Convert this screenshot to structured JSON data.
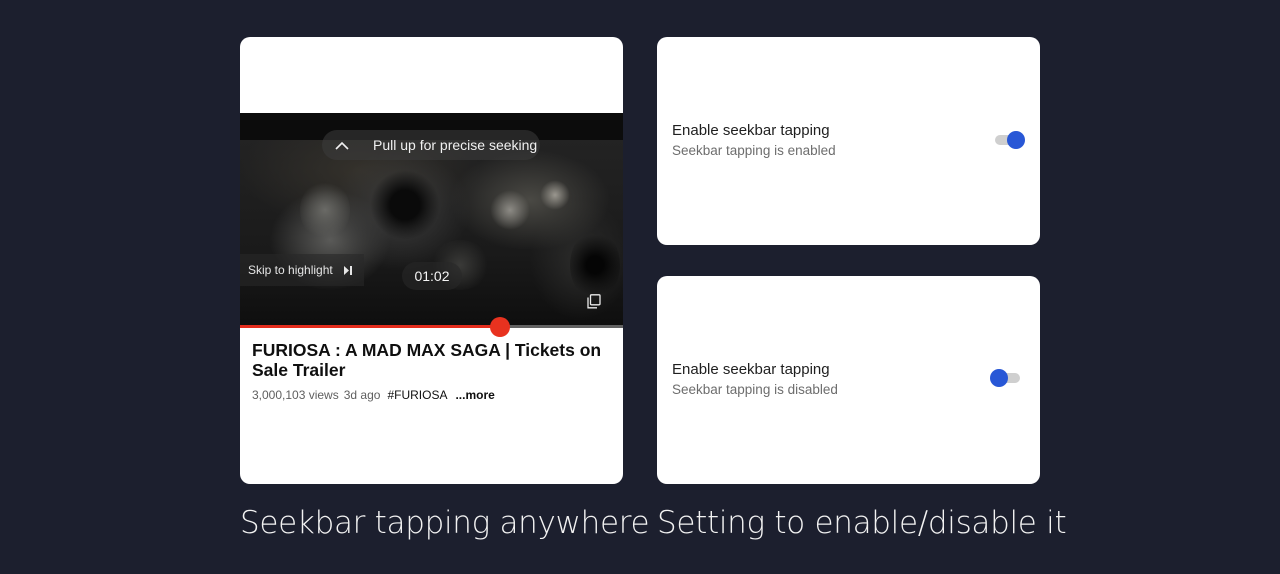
{
  "video": {
    "pull_hint": "Pull up for precise seeking",
    "skip_label": "Skip to highlight",
    "time": "01:02",
    "progress": 0.68,
    "title": "FURIOSA : A MAD MAX SAGA | Tickets on Sale Trailer",
    "views": "3,000,103 views",
    "age": "3d ago",
    "hashtag": "#FURIOSA",
    "more": "...more",
    "icons": [
      "chevron-up-icon",
      "skip-next-icon",
      "copy-icon"
    ],
    "accent_color": "#e8321f"
  },
  "settings": [
    {
      "title": "Enable seekbar tapping",
      "subtitle": "Seekbar tapping is enabled",
      "enabled": true
    },
    {
      "title": "Enable seekbar tapping",
      "subtitle": "Seekbar tapping is disabled",
      "enabled": false
    }
  ],
  "toggle_color": "#2857d6",
  "captions": {
    "left": "Seekbar tapping anywhere",
    "right": "Setting to enable/disable it"
  }
}
